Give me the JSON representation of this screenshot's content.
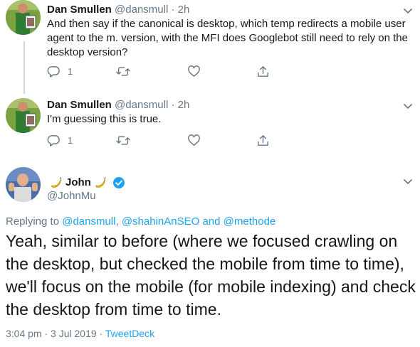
{
  "replies": [
    {
      "author": "Dan Smullen",
      "handle": "@dansmull",
      "separator": "·",
      "time": "2h",
      "text": "And then say if the canonical is desktop, which temp redirects a mobile user agent to the m. version, with the MFI does Googlebot still need to rely on the desktop version?",
      "reply_count": "1"
    },
    {
      "author": "Dan Smullen",
      "handle": "@dansmull",
      "separator": "·",
      "time": "2h",
      "text": "I'm guessing this is true.",
      "reply_count": "1"
    }
  ],
  "main_tweet": {
    "author": "John",
    "handle": "@JohnMu",
    "replying_prefix": "Replying to",
    "mention_1": "@dansmull",
    "mention_sep": ",",
    "mention_2": "@shahinAnSEO",
    "mention_and": "and",
    "mention_3": "@methode",
    "text": "Yeah, similar to before (where we focused crawling on the desktop, but checked the mobile from time to time), we'll focus on the mobile (for mobile indexing) and check the desktop from time to time.",
    "time": "3:04 pm",
    "separator": "·",
    "date": "3 Jul 2019",
    "separator_2": "·",
    "source": "TweetDeck"
  },
  "colors": {
    "link": "#1da1f2",
    "secondary_text": "#657786",
    "primary_text": "#14171a",
    "thread_line": "#ccd6dd",
    "verified": "#1da1f2"
  },
  "icons": {
    "reply": "reply-icon",
    "retweet": "retweet-icon",
    "like": "heart-icon",
    "share": "share-icon",
    "menu": "chevron-down-icon",
    "verified": "verified-badge-icon",
    "emoji": "banana-emoji-icon"
  }
}
